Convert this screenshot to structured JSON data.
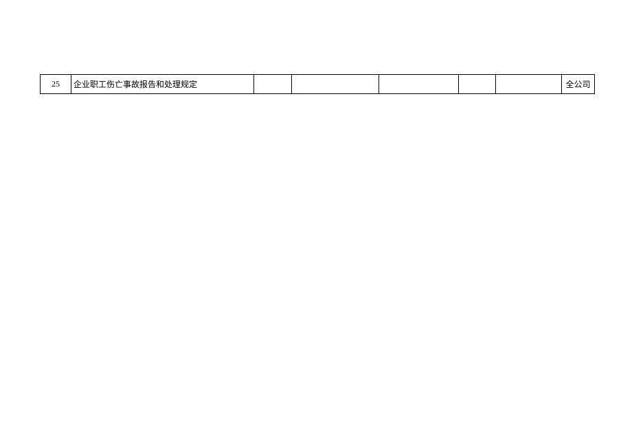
{
  "rows": [
    {
      "index": "25",
      "title": "企业职工伤亡事故报告和处理规定",
      "c3": "",
      "c4": "",
      "c5": "",
      "c6": "",
      "c7": "",
      "scope": "全公司"
    }
  ]
}
